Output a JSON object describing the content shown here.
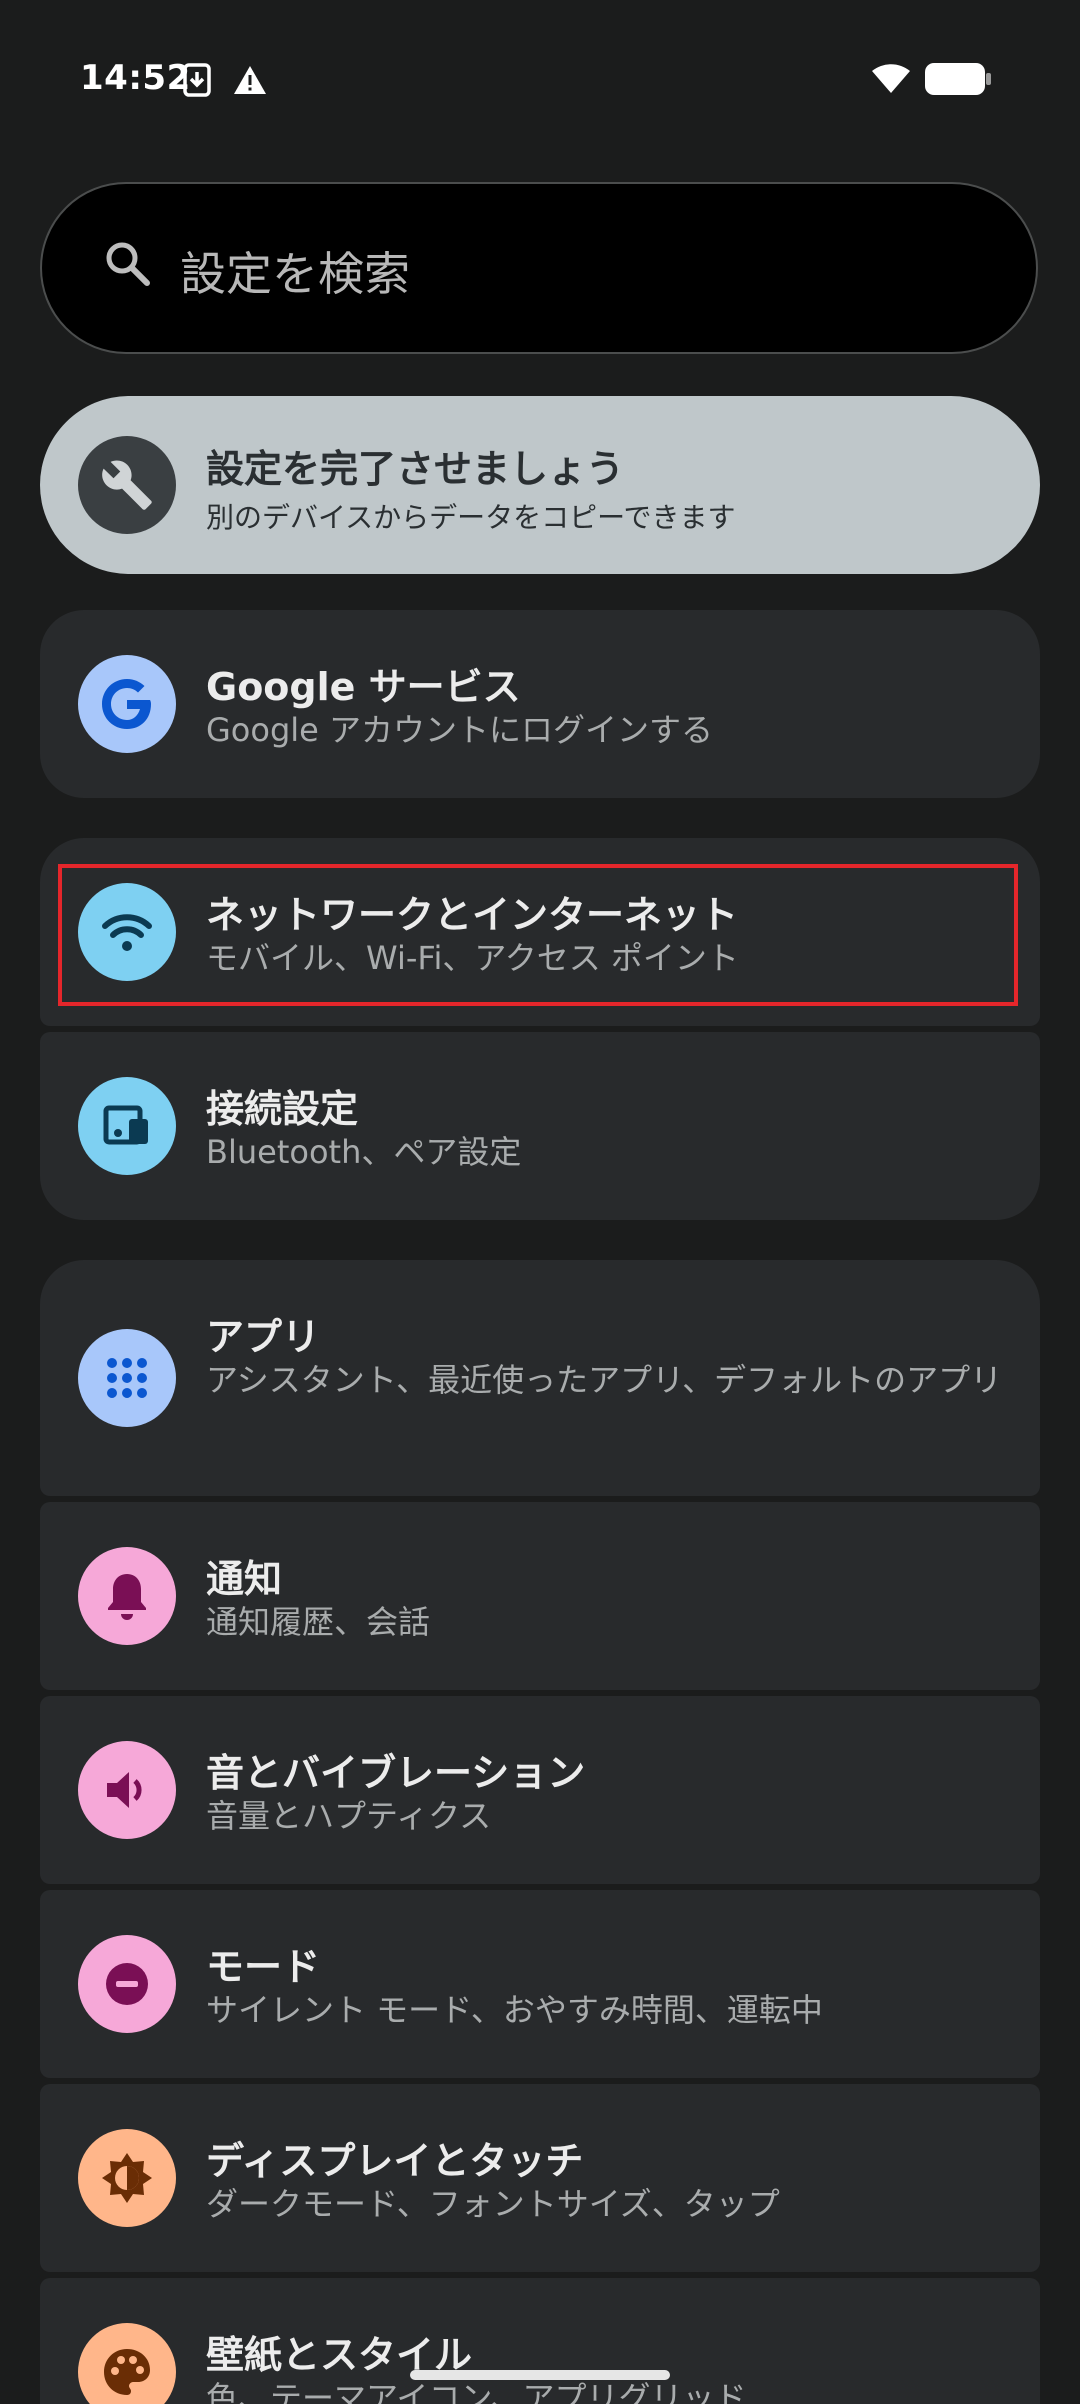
{
  "status_bar": {
    "time": "14:52",
    "icons": [
      "download-icon",
      "warning-icon",
      "wifi-icon",
      "battery-icon"
    ]
  },
  "search": {
    "placeholder": "設定を検索"
  },
  "setup_card": {
    "title": "設定を完了させましょう",
    "subtitle": "別のデバイスからデータをコピーできます",
    "icon": "wrench-icon"
  },
  "items": [
    {
      "title": "Google サービス",
      "subtitle": "Google アカウントにログインする",
      "icon": "google-icon",
      "icon_bg": "#a8c7fa"
    },
    {
      "title": "ネットワークとインターネット",
      "subtitle": "モバイル、Wi-Fi、アクセス ポイント",
      "icon": "wifi-icon",
      "icon_bg": "#7ed0f2"
    },
    {
      "title": "接続設定",
      "subtitle": "Bluetooth、ペア設定",
      "icon": "connected-devices-icon",
      "icon_bg": "#7ed0f2"
    },
    {
      "title": "アプリ",
      "subtitle": "アシスタント、最近使ったアプリ、デフォルトのアプリ",
      "icon": "apps-grid-icon",
      "icon_bg": "#a8c7fa"
    },
    {
      "title": "通知",
      "subtitle": "通知履歴、会話",
      "icon": "bell-icon",
      "icon_bg": "#f6a8d8"
    },
    {
      "title": "音とバイブレーション",
      "subtitle": "音量とハプティクス",
      "icon": "speaker-icon",
      "icon_bg": "#f6a8d8"
    },
    {
      "title": "モード",
      "subtitle": "サイレント モード、おやすみ時間、運転中",
      "icon": "do-not-disturb-icon",
      "icon_bg": "#f6a8d8"
    },
    {
      "title": "ディスプレイとタッチ",
      "subtitle": "ダークモード、フォントサイズ、タップ",
      "icon": "brightness-icon",
      "icon_bg": "#ffb68a"
    },
    {
      "title": "壁紙とスタイル",
      "subtitle": "色、テーマアイコン、アプリグリッド",
      "icon": "palette-icon",
      "icon_bg": "#ffb68a"
    }
  ],
  "colors": {
    "background": "#1b1c1c",
    "card": "#282a2c",
    "setup_card": "#bfc7ca",
    "highlight": "#e5262b"
  }
}
